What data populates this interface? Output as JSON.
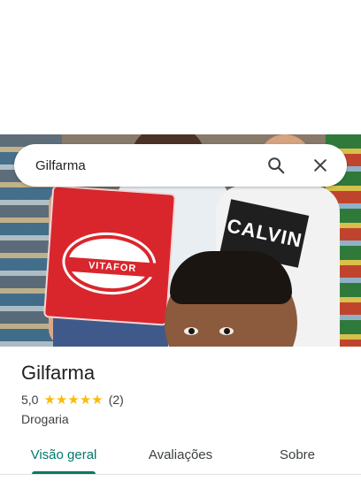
{
  "search": {
    "query": "Gilfarma"
  },
  "photo": {
    "bag_brand": "VITAFOR",
    "shirt_text": "CALVIN"
  },
  "place": {
    "name": "Gilfarma",
    "rating_text": "5,0",
    "rating_value": 5,
    "stars_max": 5,
    "review_count": "(2)",
    "category": "Drogaria"
  },
  "tabs": [
    {
      "label": "Visão geral",
      "active": true
    },
    {
      "label": "Avaliações",
      "active": false
    },
    {
      "label": "Sobre",
      "active": false
    }
  ],
  "colors": {
    "accent": "#00796b",
    "star": "#fbbc04"
  },
  "icons": {
    "search": "search-icon",
    "close": "close-icon",
    "star": "star-icon"
  }
}
